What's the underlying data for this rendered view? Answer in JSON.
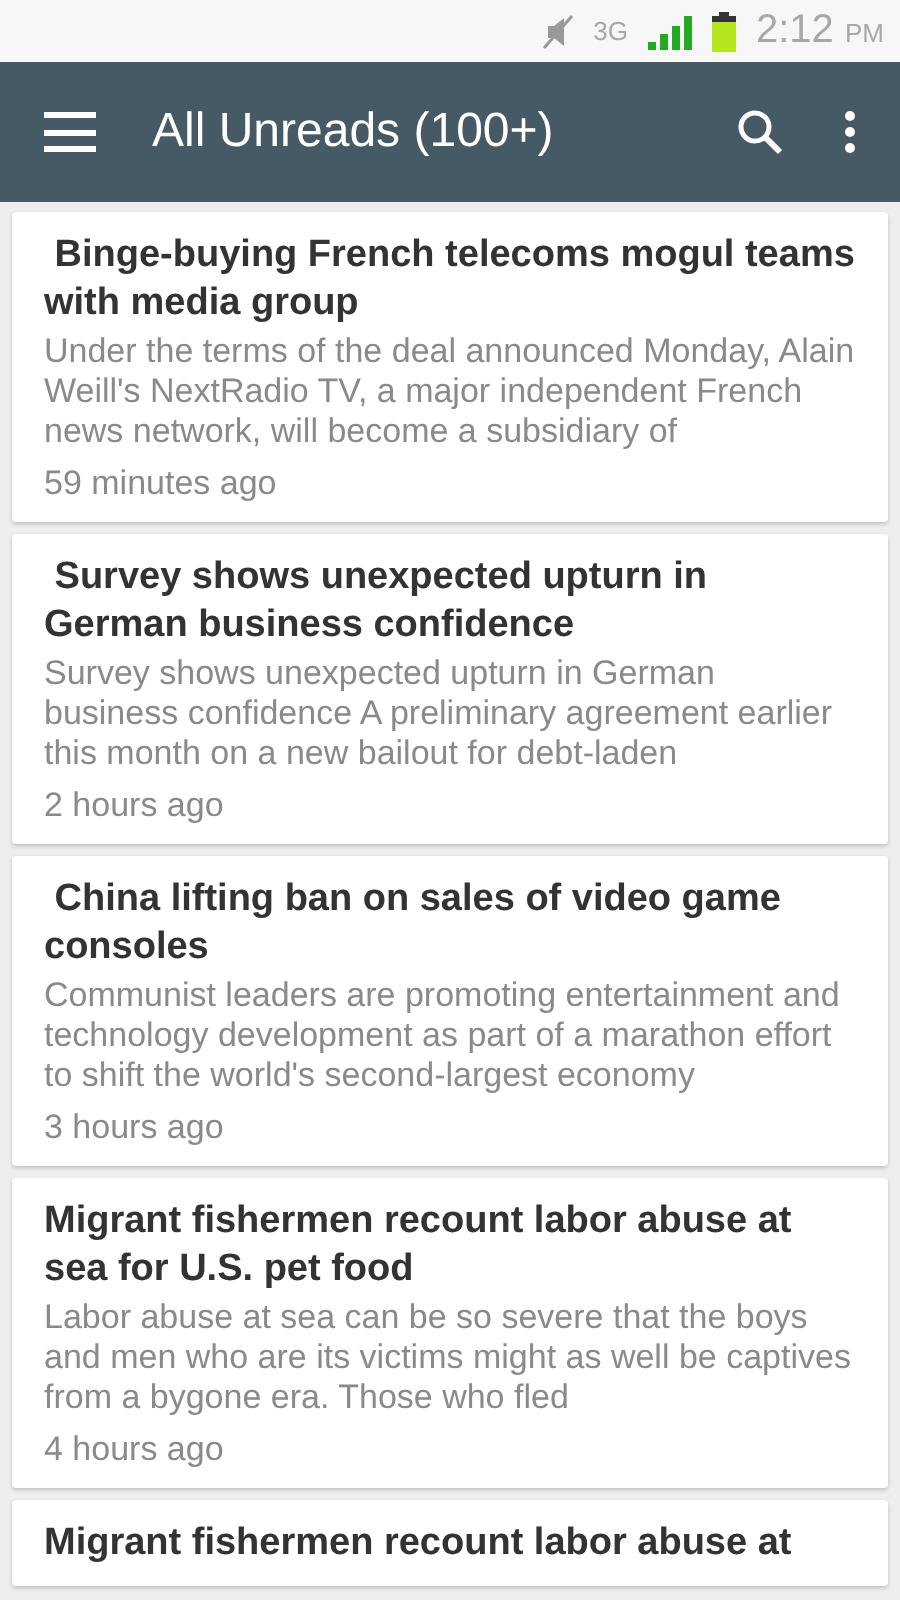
{
  "status_bar": {
    "network": "3G",
    "time": "2:12",
    "ampm": "PM"
  },
  "toolbar": {
    "title": "All Unreads (100+)"
  },
  "articles": [
    {
      "title": " Binge-buying French telecoms mogul teams with media group",
      "summary": "Under the terms of the deal announced Monday, Alain Weill's NextRadio TV, a major independent French news network, will become a subsidiary of",
      "time": "59 minutes ago"
    },
    {
      "title": " Survey shows unexpected upturn in German business confidence",
      "summary": "Survey shows unexpected upturn in German business confidence A preliminary agreement earlier this month on a new bailout for debt-laden",
      "time": "2 hours ago"
    },
    {
      "title": " China lifting ban on sales of video game consoles",
      "summary": "Communist leaders are promoting entertainment and technology development as part of a marathon effort to shift the world's second-largest economy",
      "time": "3 hours ago"
    },
    {
      "title": "Migrant fishermen recount labor abuse at sea for U.S. pet food",
      "summary": "Labor abuse at sea can be so severe that the boys and men who are its victims might as well be captives from a bygone era. Those who fled",
      "time": "4 hours ago"
    },
    {
      "title": "Migrant fishermen recount labor abuse at"
    }
  ]
}
